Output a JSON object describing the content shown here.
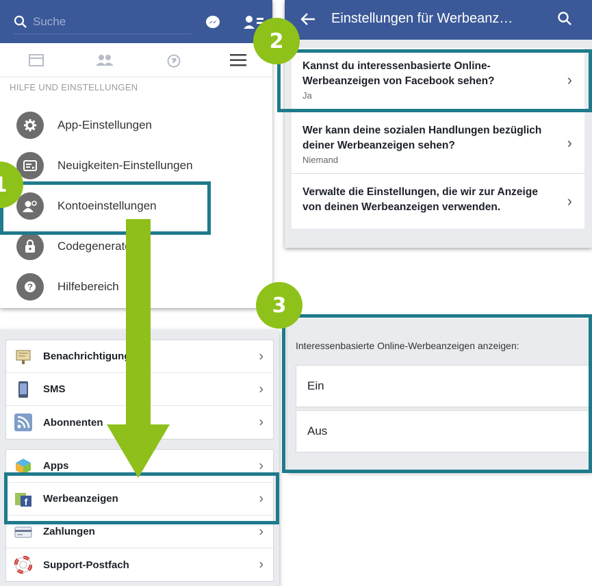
{
  "panel1": {
    "search_placeholder": "Suche",
    "section_title": "HILFE UND EINSTELLUNGEN",
    "items": [
      {
        "label": "App-Einstellungen",
        "icon": "gear-icon"
      },
      {
        "label": "Neuigkeiten-Einstellungen",
        "icon": "news-feed-icon"
      },
      {
        "label": "Kontoeinstellungen",
        "icon": "account-icon"
      },
      {
        "label": "Codegenerator",
        "icon": "lock-icon"
      },
      {
        "label": "Hilfebereich",
        "icon": "help-icon"
      }
    ]
  },
  "panel2": {
    "title": "Einstellungen für Werbeanz…",
    "settings": [
      {
        "question": "Kannst du interessenbasierte Online-Werbeanzeigen von Facebook sehen?",
        "value": "Ja"
      },
      {
        "question": "Wer kann deine sozialen Handlungen bezüglich deiner Werbeanzeigen sehen?",
        "value": "Niemand"
      },
      {
        "question": "Verwalte die Einstellungen, die wir zur Anzeige von deinen Werbeanzeigen verwenden.",
        "value": ""
      }
    ]
  },
  "panel3": {
    "group1": [
      {
        "label": "Benachrichtigungen",
        "icon": "notifications-icon"
      },
      {
        "label": "SMS",
        "icon": "sms-icon"
      },
      {
        "label": "Abonnenten",
        "icon": "rss-icon"
      }
    ],
    "group2": [
      {
        "label": "Apps",
        "icon": "apps-icon"
      },
      {
        "label": "Werbeanzeigen",
        "icon": "ads-icon"
      },
      {
        "label": "Zahlungen",
        "icon": "card-icon"
      },
      {
        "label": "Support-Postfach",
        "icon": "lifebuoy-icon"
      }
    ]
  },
  "panel4": {
    "label": "Interessenbasierte Online-Werbeanzeigen anzeigen:",
    "options": [
      "Ein",
      "Aus"
    ]
  },
  "badges": {
    "b1": "1",
    "b2": "2",
    "b3": "3"
  },
  "colors": {
    "facebook_blue": "#3b5998",
    "highlight": "#1f7a8c",
    "badge_green": "#8ec21a",
    "arrow_green": "#8fbf1a"
  }
}
